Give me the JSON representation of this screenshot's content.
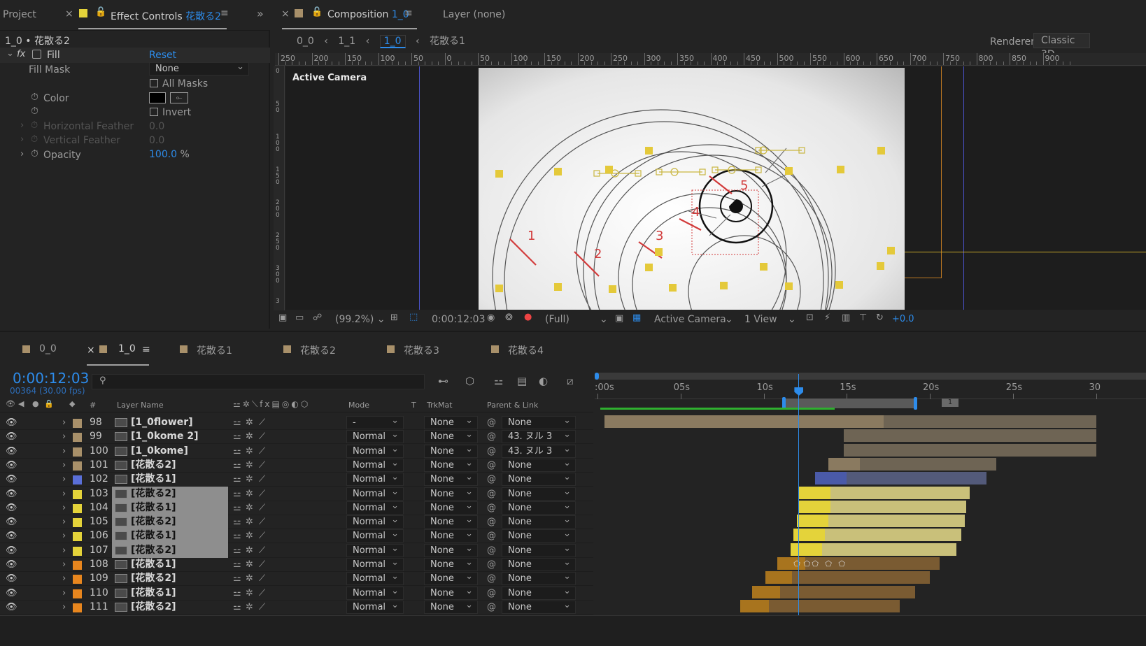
{
  "left_panel": {
    "tab_project": "Project",
    "tab_effect_controls_prefix": "Effect Controls",
    "tab_effect_controls_layer": "花散る2",
    "breadcrumb": "1_0 • 花散る2",
    "effect_name": "Fill",
    "reset_label": "Reset",
    "props": [
      {
        "label": "Fill Mask",
        "value": "None"
      },
      {
        "label": "",
        "value": "All Masks"
      },
      {
        "label": "Color",
        "value": ""
      },
      {
        "label": "",
        "value": "Invert"
      },
      {
        "label": "Horizontal Feather",
        "value": "0.0"
      },
      {
        "label": "Vertical Feather",
        "value": "0.0"
      },
      {
        "label": "Opacity",
        "value": "100.0",
        "unit": "%"
      }
    ]
  },
  "comp_panel": {
    "tab_label": "Composition",
    "tab_comp": "1_0",
    "layer_tab": "Layer",
    "layer_value": "(none)",
    "crumbs": [
      "0_0",
      "1_1",
      "1_0",
      "花散る1"
    ],
    "renderer_label": "Renderer:",
    "renderer_value": "Classic 3D",
    "ruler_labels": [
      "250",
      "200",
      "150",
      "100",
      "50",
      "0",
      "50",
      "100",
      "150",
      "200",
      "250",
      "300",
      "350",
      "400",
      "450",
      "500",
      "550",
      "600",
      "650",
      "700",
      "750",
      "800",
      "850",
      "900"
    ],
    "vruler_labels": [
      "0",
      "5 0",
      "1 0 0",
      "1 5 0",
      "2 0 0",
      "2 5 0",
      "3 0 0",
      "3"
    ],
    "view_label": "Active Camera",
    "annotations": [
      "1",
      "2",
      "3",
      "4",
      "5"
    ],
    "footer": {
      "zoom": "(99.2%)",
      "timecode": "0:00:12:03",
      "resolution": "(Full)",
      "camera": "Active Camera",
      "views": "1 View",
      "exposure": "+0.0"
    }
  },
  "timeline_tabs": [
    {
      "label": "0_0",
      "color": "#a8906a",
      "active": false
    },
    {
      "label": "1_0",
      "color": "#a8906a",
      "active": true
    },
    {
      "label": "花散る1",
      "color": "#a8906a",
      "active": false
    },
    {
      "label": "花散る2",
      "color": "#a8906a",
      "active": false
    },
    {
      "label": "花散る3",
      "color": "#a8906a",
      "active": false
    },
    {
      "label": "花散る4",
      "color": "#a8906a",
      "active": false
    }
  ],
  "timeline": {
    "timecode": "0:00:12:03",
    "frames": "00364 (30.00 fps)",
    "headers": {
      "num": "#",
      "layer_name": "Layer Name",
      "mode": "Mode",
      "t": "T",
      "trkmat": "TrkMat",
      "parent": "Parent & Link"
    },
    "ruler": [
      ":00s",
      "05s",
      "10s",
      "15s",
      "20s",
      "25s",
      "30"
    ],
    "playhead_seconds": 12.1,
    "layers": [
      {
        "num": "98",
        "color": "#a8906a",
        "name": "[1_0flower]",
        "mode": "-",
        "trkmat": "None",
        "parent": "None",
        "selected": false
      },
      {
        "num": "99",
        "color": "#a8906a",
        "name": "[1_0kome 2]",
        "mode": "Normal",
        "trkmat": "None",
        "parent": "43. ヌル 3",
        "selected": false
      },
      {
        "num": "100",
        "color": "#a8906a",
        "name": "[1_0kome]",
        "mode": "Normal",
        "trkmat": "None",
        "parent": "43. ヌル 3",
        "selected": false
      },
      {
        "num": "101",
        "color": "#a8906a",
        "name": "[花散る2]",
        "mode": "Normal",
        "trkmat": "None",
        "parent": "None",
        "selected": false
      },
      {
        "num": "102",
        "color": "#5a6fd8",
        "name": "[花散る1]",
        "mode": "Normal",
        "trkmat": "None",
        "parent": "None",
        "selected": false
      },
      {
        "num": "103",
        "color": "#e4d33a",
        "name": "[花散る2]",
        "mode": "Normal",
        "trkmat": "None",
        "parent": "None",
        "selected": true
      },
      {
        "num": "104",
        "color": "#e4d33a",
        "name": "[花散る1]",
        "mode": "Normal",
        "trkmat": "None",
        "parent": "None",
        "selected": true
      },
      {
        "num": "105",
        "color": "#e4d33a",
        "name": "[花散る2]",
        "mode": "Normal",
        "trkmat": "None",
        "parent": "None",
        "selected": true
      },
      {
        "num": "106",
        "color": "#e4d33a",
        "name": "[花散る1]",
        "mode": "Normal",
        "trkmat": "None",
        "parent": "None",
        "selected": true
      },
      {
        "num": "107",
        "color": "#e4d33a",
        "name": "[花散る2]",
        "mode": "Normal",
        "trkmat": "None",
        "parent": "None",
        "selected": true
      },
      {
        "num": "108",
        "color": "#e8861e",
        "name": "[花散る1]",
        "mode": "Normal",
        "trkmat": "None",
        "parent": "None",
        "selected": false
      },
      {
        "num": "109",
        "color": "#e8861e",
        "name": "[花散る2]",
        "mode": "Normal",
        "trkmat": "None",
        "parent": "None",
        "selected": false
      },
      {
        "num": "110",
        "color": "#e8861e",
        "name": "[花散る1]",
        "mode": "Normal",
        "trkmat": "None",
        "parent": "None",
        "selected": false
      },
      {
        "num": "111",
        "color": "#e8861e",
        "name": "[花散る2]",
        "mode": "Normal",
        "trkmat": "None",
        "parent": "None",
        "selected": false
      }
    ]
  }
}
